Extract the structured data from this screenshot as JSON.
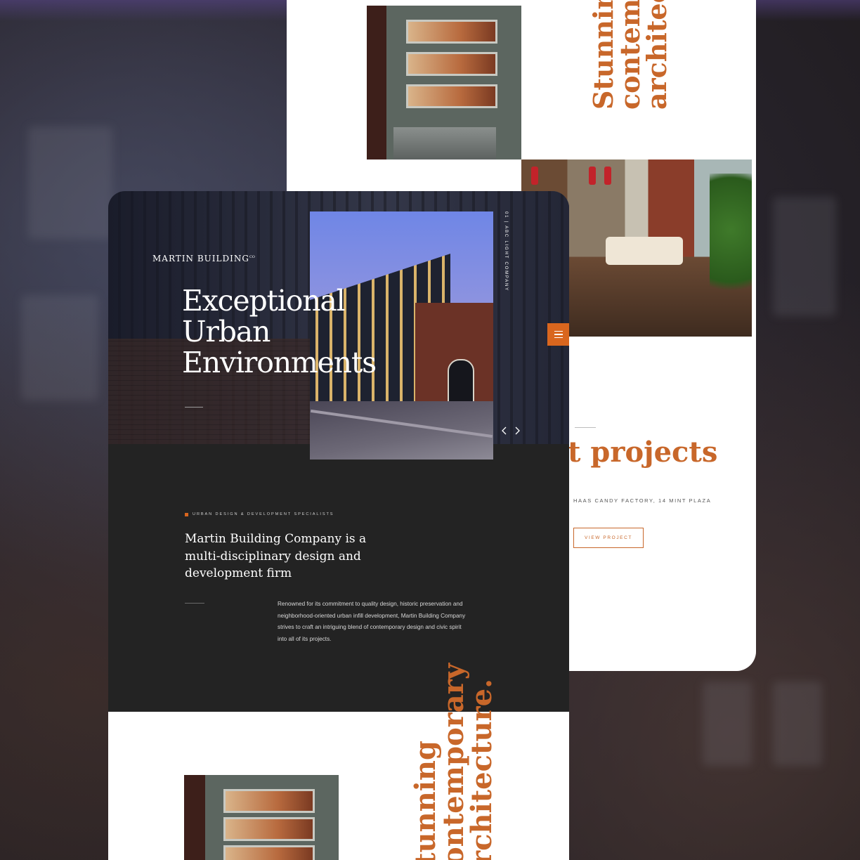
{
  "colors": {
    "accent": "#d9661e",
    "accent_text": "#c8672a",
    "dark_panel": "#232323"
  },
  "back_page": {
    "vertical_heading": [
      "Stunning",
      "contemp",
      "architect"
    ],
    "projects_heading": "t projects",
    "project_location": "HAAS CANDY FACTORY, 14 MINT PLAZA",
    "view_button": "VIEW PROJECT"
  },
  "front_page": {
    "logo": "MARTIN BUILDING",
    "logo_superscript": "CO",
    "hero_title": [
      "Exceptional",
      "Urban",
      "Environments"
    ],
    "vertical_caption": "01 | ABC LIGHT COMPANY",
    "menu_icon": "hamburger-menu-icon",
    "slider_prev_icon": "chevron-left-icon",
    "slider_next_icon": "chevron-right-icon",
    "eyebrow": "URBAN DESIGN & DEVELOPMENT SPECIALISTS",
    "lead": "Martin Building Company is a multi-disciplinary design and development firm",
    "body": "Renowned for its commitment to quality design, historic preservation and neighborhood-oriented urban infill development, Martin Building Company strives to craft an intriguing blend of contemporary design and civic spirit into all of its projects.",
    "vertical_heading": [
      "tunning",
      "ontemporary",
      "rchitecture."
    ]
  }
}
